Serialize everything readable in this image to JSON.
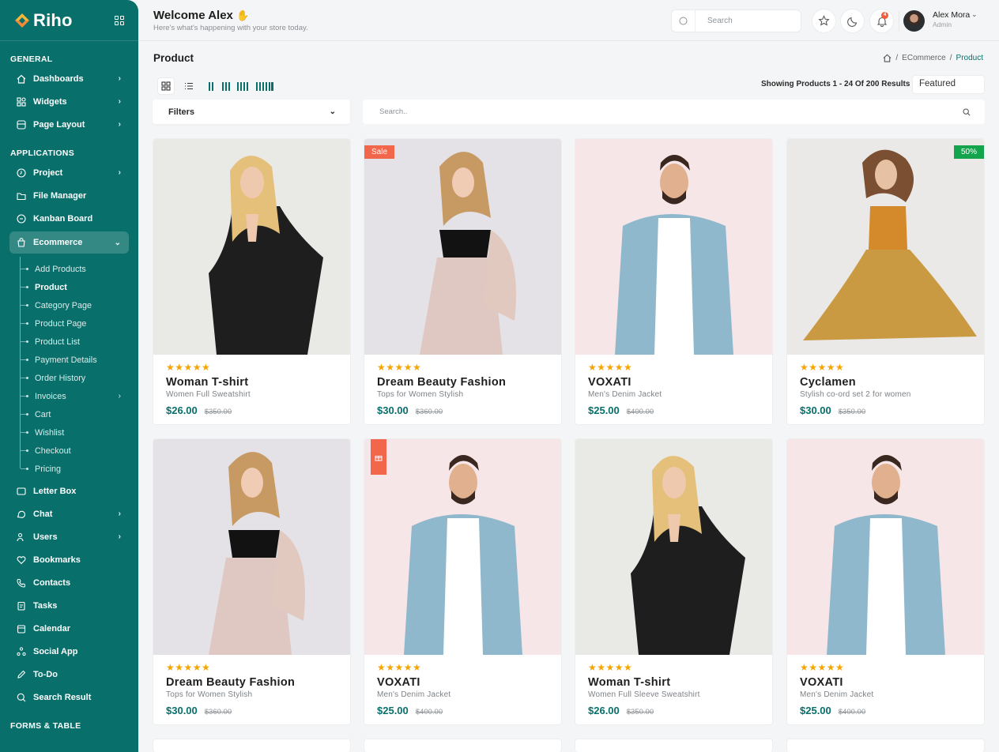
{
  "brand": {
    "name": "Riho"
  },
  "colors": {
    "primary": "#086f6b",
    "accent_star": "#f6a400",
    "sale_tag": "#f2664b",
    "percent_tag": "#14a44d"
  },
  "sidebar": {
    "sections": [
      {
        "title": "GENERAL",
        "items": [
          {
            "label": "Dashboards",
            "icon": "home-icon",
            "has_children": true
          },
          {
            "label": "Widgets",
            "icon": "widgets-icon",
            "has_children": true
          },
          {
            "label": "Page Layout",
            "icon": "layout-icon",
            "has_children": true
          }
        ]
      },
      {
        "title": "APPLICATIONS",
        "items": [
          {
            "label": "Project",
            "icon": "project-icon",
            "has_children": true
          },
          {
            "label": "File Manager",
            "icon": "folder-icon",
            "has_children": false
          },
          {
            "label": "Kanban Board",
            "icon": "kanban-icon",
            "has_children": false
          },
          {
            "label": "Ecommerce",
            "icon": "bag-icon",
            "has_children": true,
            "expanded": true
          }
        ]
      }
    ],
    "ecommerce_sub": [
      "Add Products",
      "Product",
      "Category Page",
      "Product Page",
      "Product List",
      "Payment Details",
      "Order History",
      "Invoices",
      "Cart",
      "Wishlist",
      "Checkout",
      "Pricing"
    ],
    "after_items": [
      {
        "label": "Letter Box",
        "icon": "mail-icon",
        "has_children": false
      },
      {
        "label": "Chat",
        "icon": "chat-icon",
        "has_children": true
      },
      {
        "label": "Users",
        "icon": "users-icon",
        "has_children": true
      },
      {
        "label": "Bookmarks",
        "icon": "heart-icon",
        "has_children": false
      },
      {
        "label": "Contacts",
        "icon": "phone-icon",
        "has_children": false
      },
      {
        "label": "Tasks",
        "icon": "tasks-icon",
        "has_children": false
      },
      {
        "label": "Calendar",
        "icon": "calendar-icon",
        "has_children": false
      },
      {
        "label": "Social App",
        "icon": "social-icon",
        "has_children": false
      },
      {
        "label": "To-Do",
        "icon": "pen-icon",
        "has_children": false
      },
      {
        "label": "Search Result",
        "icon": "search-icon",
        "has_children": false
      }
    ],
    "bottom_section_title": "FORMS & TABLE"
  },
  "header": {
    "welcome": "Welcome Alex",
    "wave": "✋",
    "subtitle": "Here's what's happening with your store today.",
    "search_placeholder": "Search",
    "notification_count": "4",
    "user_name": "Alex Mora",
    "user_role": "Admin"
  },
  "page": {
    "title": "Product",
    "breadcrumb": [
      "ECommerce",
      "Product"
    ],
    "results_text": "Showing Products 1 - 24 Of 200 Results",
    "sort_value": "Featured",
    "filters_label": "Filters",
    "search_placeholder": "Search.."
  },
  "products": [
    {
      "name": "Woman T-shirt",
      "desc": "Women Full Sweatshirt",
      "price": "$26.00",
      "old_price": "$350.00",
      "rating": 5,
      "tag": ""
    },
    {
      "name": "Dream Beauty Fashion",
      "desc": "Tops for Women Stylish",
      "price": "$30.00",
      "old_price": "$360.00",
      "rating": 5,
      "tag": "Sale"
    },
    {
      "name": "VOXATI",
      "desc": "Men's Denim Jacket",
      "price": "$25.00",
      "old_price": "$400.00",
      "rating": 5,
      "tag": ""
    },
    {
      "name": "Cyclamen",
      "desc": "Stylish co-ord set 2 for women",
      "price": "$30.00",
      "old_price": "$350.00",
      "rating": 5,
      "tag": "50%"
    },
    {
      "name": "Dream Beauty Fashion",
      "desc": "Tops for Women Stylish",
      "price": "$30.00",
      "old_price": "$360.00",
      "rating": 5,
      "tag": ""
    },
    {
      "name": "VOXATI",
      "desc": "Men's Denim Jacket",
      "price": "$25.00",
      "old_price": "$400.00",
      "rating": 5,
      "tag": "gift"
    },
    {
      "name": "Woman T-shirt",
      "desc": "Women Full Sleeve Sweatshirt",
      "price": "$26.00",
      "old_price": "$350.00",
      "rating": 5,
      "tag": ""
    },
    {
      "name": "VOXATI",
      "desc": "Men's Denim Jacket",
      "price": "$25.00",
      "old_price": "$400.00",
      "rating": 5,
      "tag": ""
    }
  ]
}
